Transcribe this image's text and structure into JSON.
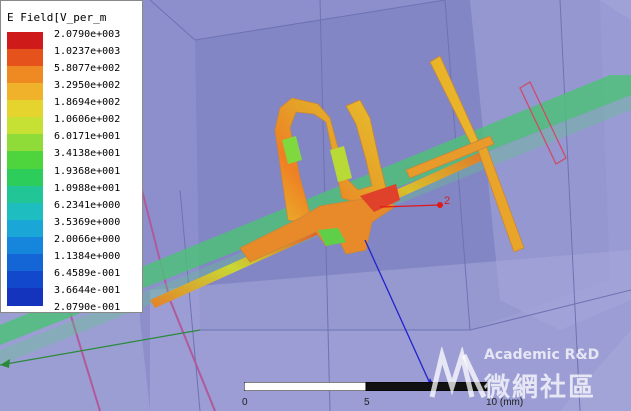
{
  "legend": {
    "title": "E Field[V_per_m",
    "values": [
      "2.0790e+003",
      "1.0237e+003",
      "5.8077e+002",
      "3.2950e+002",
      "1.8694e+002",
      "1.0606e+002",
      "6.0171e+001",
      "3.4138e+001",
      "1.9368e+001",
      "1.0988e+001",
      "6.2341e+000",
      "3.5369e+000",
      "2.0066e+000",
      "1.1384e+000",
      "6.4589e-001",
      "3.6644e-001",
      "2.0790e-001"
    ],
    "colors": [
      "#cf1a1a",
      "#e5521c",
      "#ef8a22",
      "#f0b22a",
      "#e6d42e",
      "#c6e034",
      "#8fdc38",
      "#4ed43c",
      "#2ccd5a",
      "#22c595",
      "#1ebdbf",
      "#1aa6d6",
      "#1686dc",
      "#1466d6",
      "#1248cc",
      "#1434bd"
    ]
  },
  "scale": {
    "tick_0": "0",
    "tick_5": "5",
    "tick_10": "10 (mm)"
  },
  "axis": {
    "origin_label": "2"
  },
  "watermark": {
    "line1": "Academic R&D",
    "line2": "微網社區"
  },
  "colors": {
    "background": "#9b9ed3",
    "substrate": "#8589c4",
    "feedline": "#4fbf7a",
    "axis_red": "#e01818",
    "axis_blue": "#2222cc",
    "boundary": "#b05a9a"
  }
}
